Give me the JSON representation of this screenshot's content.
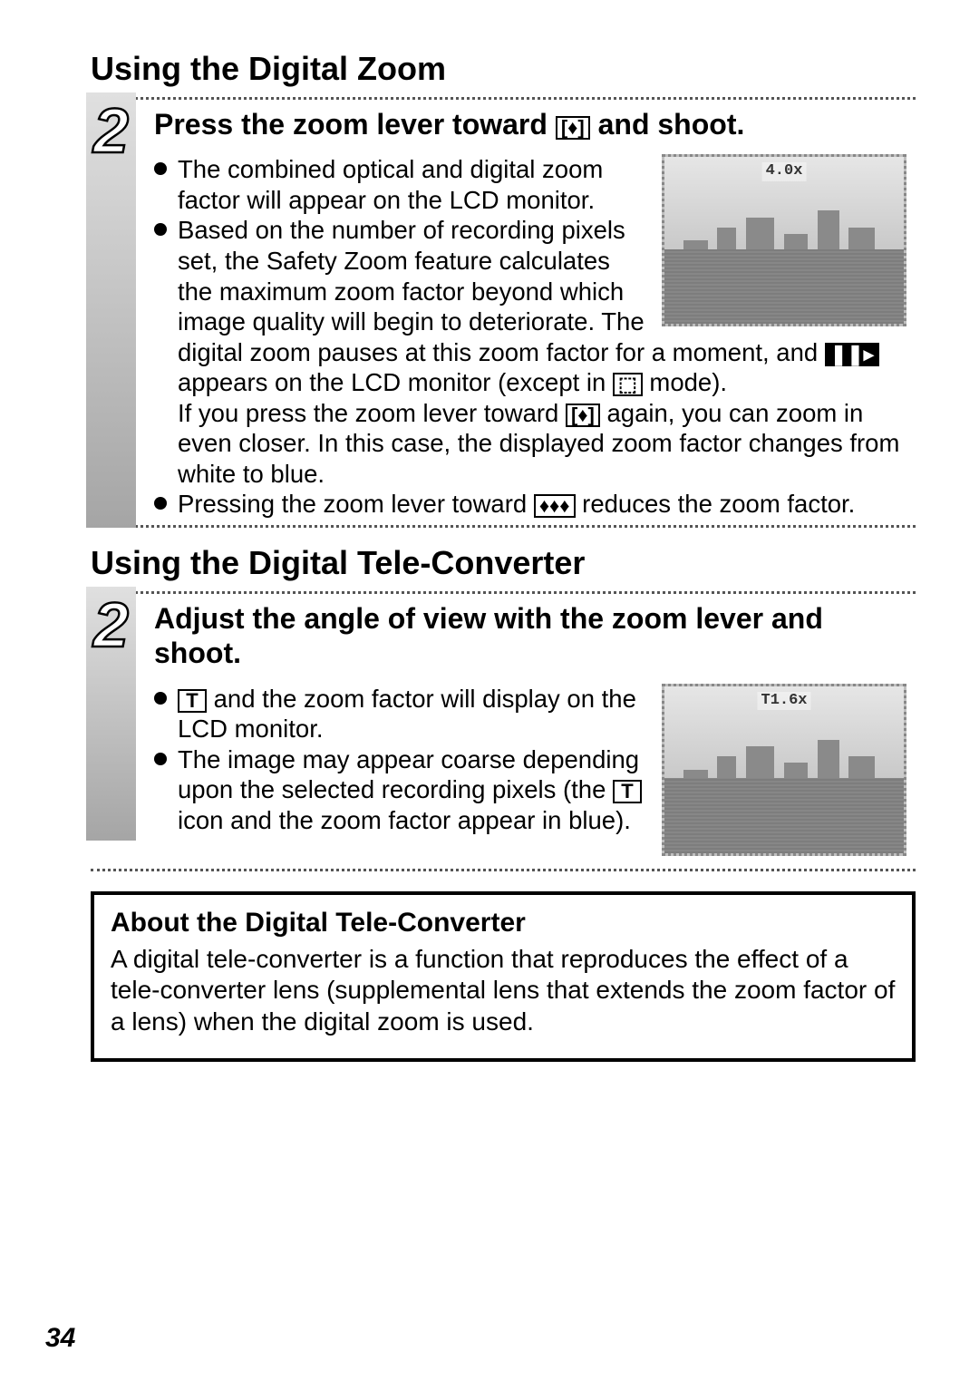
{
  "section1": {
    "heading": "Using the Digital Zoom",
    "step_number": "2",
    "instruction_pre": "Press the zoom lever toward ",
    "instruction_icon": "[♦]",
    "instruction_post": " and shoot.",
    "zoom_label": "4.0x",
    "bullet1": "The combined optical and digital zoom factor will appear on the LCD monitor.",
    "bullet2_a": "Based on the number of recording pixels set, the Safety Zoom feature calculates the maximum zoom factor beyond which image quality will begin to deteriorate. The digital zoom pauses at this zoom factor for a moment, and ",
    "bullet2_icon1": "❚❚▸",
    "bullet2_b": " appears on the LCD monitor (except in ",
    "bullet2_icon2": "⬚",
    "bullet2_c": " mode).",
    "bullet2_line2_a": "If you press the zoom lever toward ",
    "bullet2_line2_icon": "[♦]",
    "bullet2_line2_b": " again, you can zoom in even closer. In this case, the displayed zoom factor changes from white to blue.",
    "bullet3_a": "Pressing the zoom lever toward ",
    "bullet3_icon": "♦♦♦",
    "bullet3_b": " reduces the zoom factor."
  },
  "section2": {
    "heading": "Using the Digital Tele-Converter",
    "step_number": "2",
    "instruction": "Adjust the angle of view with the zoom lever and shoot.",
    "zoom_label": "T1.6x",
    "bullet1_icon": "T",
    "bullet1_a": " and the zoom factor will display on the LCD monitor.",
    "bullet2_a": "The image may appear coarse depending upon the selected recording pixels (the ",
    "bullet2_icon": "T",
    "bullet2_b": " icon and the zoom factor appear in blue)."
  },
  "about": {
    "title": "About the Digital Tele-Converter",
    "text": "A digital tele-converter is a function that reproduces the effect of a tele-converter lens (supplemental lens that extends the zoom factor of a lens) when the digital zoom is used."
  },
  "page_number": "34"
}
